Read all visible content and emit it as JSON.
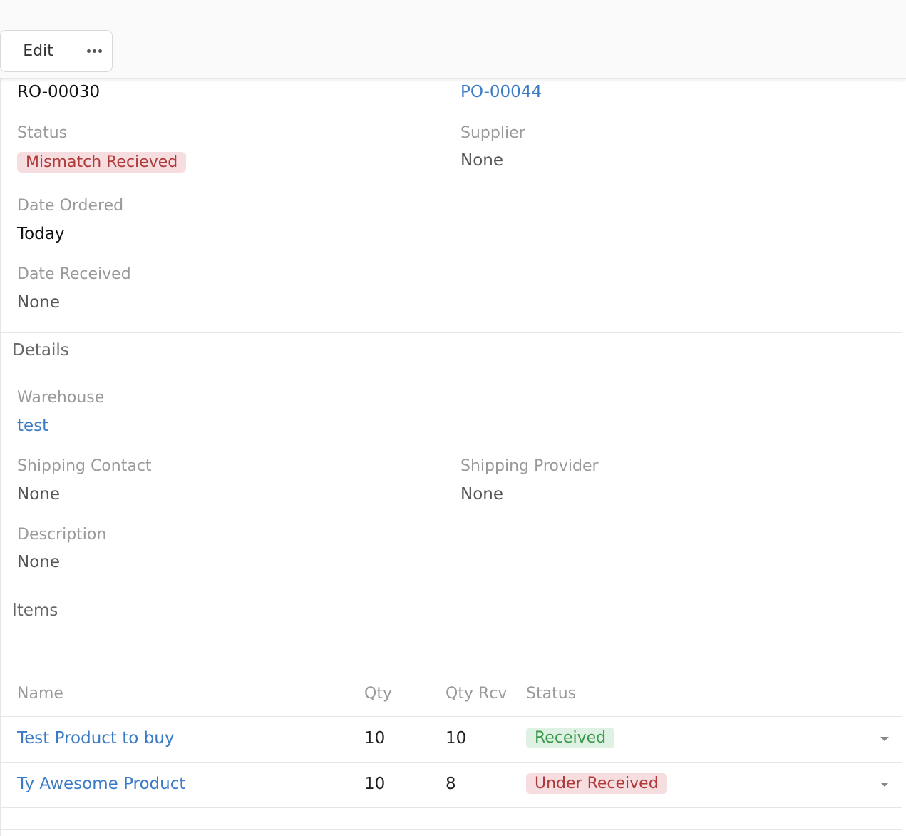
{
  "toolbar": {
    "edit_label": "Edit",
    "more_icon": "more-horizontal-icon"
  },
  "record": {
    "id": "RO-00030",
    "purchase_order": "PO-00044",
    "status_label": "Status",
    "status_value": "Mismatch Recieved",
    "supplier_label": "Supplier",
    "supplier_value": "None",
    "date_ordered_label": "Date Ordered",
    "date_ordered_value": "Today",
    "date_received_label": "Date Received",
    "date_received_value": "None"
  },
  "details": {
    "title": "Details",
    "warehouse_label": "Warehouse",
    "warehouse_value": "test",
    "shipping_contact_label": "Shipping Contact",
    "shipping_contact_value": "None",
    "shipping_provider_label": "Shipping Provider",
    "shipping_provider_value": "None",
    "description_label": "Description",
    "description_value": "None"
  },
  "items": {
    "title": "Items",
    "columns": [
      "Name",
      "Qty",
      "Qty Rcv",
      "Status"
    ],
    "rows": [
      {
        "name": "Test Product to buy",
        "qty": "10",
        "qty_rcv": "10",
        "status": "Received"
      },
      {
        "name": "Ty Awesome Product",
        "qty": "10",
        "qty_rcv": "8",
        "status": "Under Received"
      }
    ]
  },
  "colors": {
    "link": "#3b7ac6",
    "badge_red_bg": "#f6dde0",
    "badge_red_text": "#b03a3a",
    "badge_green_bg": "#dff1e2",
    "badge_green_text": "#3a9a4c"
  }
}
